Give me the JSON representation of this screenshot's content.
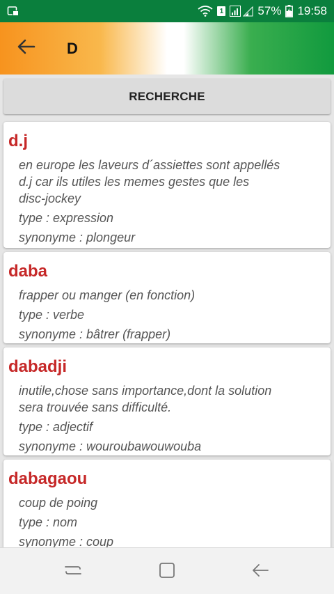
{
  "status_bar": {
    "sim_slot": "1",
    "battery": "57%",
    "time": "19:58"
  },
  "app_bar": {
    "title": "D"
  },
  "search": {
    "label": "RECHERCHE"
  },
  "entries": [
    {
      "word": "d.j",
      "definition": [
        "en europe les laveurs d´assiettes sont appellés",
        "d.j car ils utiles les memes gestes que les",
        "disc-jockey"
      ],
      "type": "type : expression",
      "synonym": "synonyme : plongeur"
    },
    {
      "word": "daba",
      "definition": [
        "frapper ou manger (en fonction)"
      ],
      "type": "type : verbe",
      "synonym": "synonyme : bâtrer (frapper)"
    },
    {
      "word": "dabadji",
      "definition": [
        "inutile,chose sans importance,dont la solution",
        "sera trouvée sans difficulté."
      ],
      "type": "type : adjectif",
      "synonym": "synonyme : wouroubawouwouba"
    },
    {
      "word": "dabagaou",
      "definition": [
        "coup de poing"
      ],
      "type": "type : nom",
      "synonym": "synonyme : coup"
    }
  ],
  "colors": {
    "status_bar": "#0a7f3d",
    "word": "#c62828",
    "gradient_orange": "#f7931e",
    "gradient_green": "#119a3e"
  },
  "icons": {
    "status_left": "screen-cast-icon",
    "wifi": "wifi-icon",
    "signal": "signal-icon",
    "battery": "battery-charging-icon",
    "back": "arrow-left-icon",
    "nav_recents": "recents-icon",
    "nav_home": "home-square-icon",
    "nav_back": "nav-back-icon"
  }
}
